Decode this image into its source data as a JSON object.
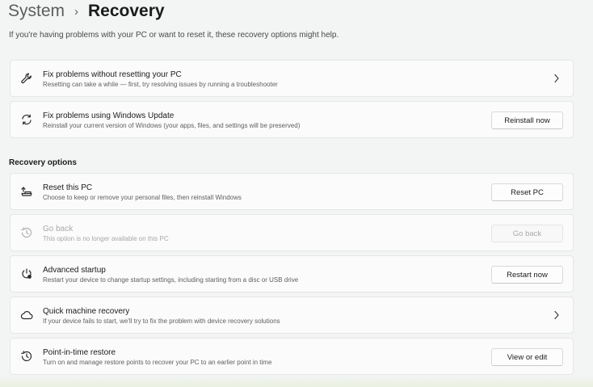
{
  "breadcrumb": {
    "parent": "System",
    "separator": "›",
    "current": "Recovery"
  },
  "subtitle": "If you're having problems with your PC or want to reset it, these recovery options might help.",
  "top_cards": [
    {
      "title": "Fix problems without resetting your PC",
      "description": "Resetting can take a while — first, try resolving issues by running a troubleshooter",
      "icon": "wrench-icon",
      "action": "chevron-right-icon"
    },
    {
      "title": "Fix problems using Windows Update",
      "description": "Reinstall your current version of Windows (your apps, files, and settings will be preserved)",
      "icon": "refresh-icon",
      "button": "Reinstall now"
    }
  ],
  "recovery_options": {
    "header": "Recovery options",
    "items": [
      {
        "title": "Reset this PC",
        "description": "Choose to keep or remove your personal files, then reinstall Windows",
        "icon": "reset-pc-icon",
        "button": "Reset PC"
      },
      {
        "title": "Go back",
        "description": "This option is no longer available on this PC",
        "icon": "history-icon",
        "button": "Go back",
        "disabled": true
      },
      {
        "title": "Advanced startup",
        "description": "Restart your device to change startup settings, including starting from a disc or USB drive",
        "icon": "advanced-startup-icon",
        "button": "Restart now"
      },
      {
        "title": "Quick machine recovery",
        "description": "If your device fails to start, we'll try to fix the problem with device recovery solutions",
        "icon": "cloud-icon",
        "action": "chevron-right-icon"
      },
      {
        "title": "Point-in-time restore",
        "description": "Turn on and manage restore points to recover your PC to an earlier point in time",
        "icon": "restore-icon",
        "button": "View or edit"
      }
    ]
  }
}
